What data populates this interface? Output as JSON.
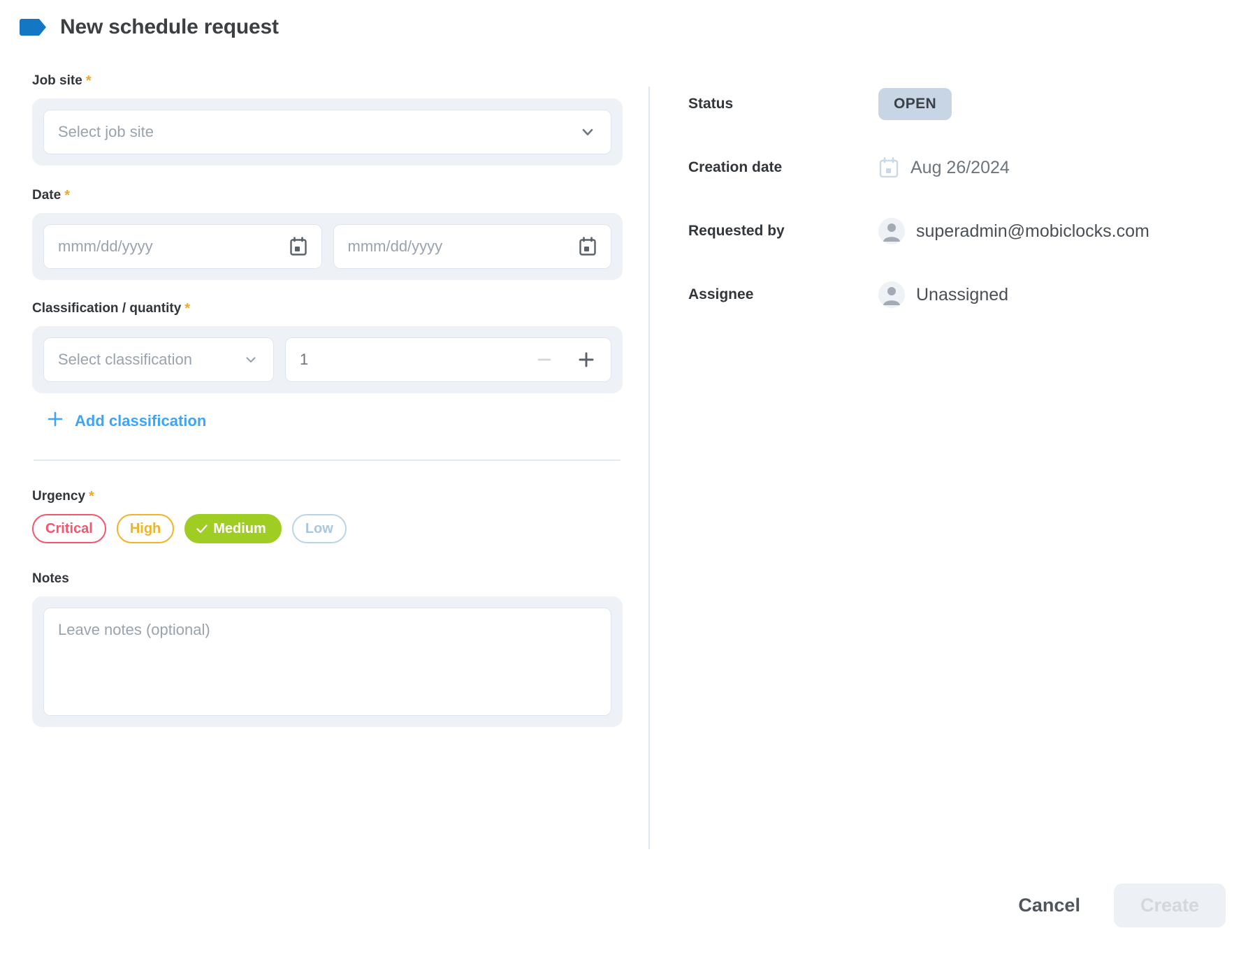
{
  "header": {
    "title": "New schedule request",
    "icon": "tag-icon",
    "icon_color": "#1477c4"
  },
  "form": {
    "job_site": {
      "label": "Job site",
      "required": true,
      "placeholder": "Select job site",
      "value": "",
      "icon": "chevron-down-icon"
    },
    "date": {
      "label": "Date",
      "required": true,
      "start_placeholder": "mmm/dd/yyyy",
      "end_placeholder": "mmm/dd/yyyy",
      "start_value": "",
      "end_value": "",
      "icon": "calendar-icon"
    },
    "classification": {
      "label": "Classification / quantity",
      "required": true,
      "placeholder": "Select classification",
      "value": "",
      "quantity": "1",
      "decrement_label": "−",
      "increment_label": "+",
      "add_label": "Add classification",
      "add_icon": "plus-icon"
    },
    "urgency": {
      "label": "Urgency",
      "required": true,
      "selected": "Medium",
      "options": [
        {
          "label": "Critical",
          "color": "#f4566c",
          "selected": false
        },
        {
          "label": "High",
          "color": "#f0b429",
          "selected": false
        },
        {
          "label": "Medium",
          "color": "#9fcd24",
          "selected": true
        },
        {
          "label": "Low",
          "color": "#a9c8de",
          "selected": false
        }
      ]
    },
    "notes": {
      "label": "Notes",
      "required": false,
      "placeholder": "Leave notes (optional)",
      "value": ""
    }
  },
  "details": {
    "status": {
      "label": "Status",
      "value": "OPEN",
      "badge_color": "#c7d5e4"
    },
    "creation_date": {
      "label": "Creation date",
      "value": "Aug 26/2024",
      "icon": "calendar-icon"
    },
    "requested_by": {
      "label": "Requested by",
      "value": "superadmin@mobiclocks.com",
      "icon": "avatar-icon"
    },
    "assignee": {
      "label": "Assignee",
      "value": "Unassigned",
      "icon": "avatar-icon"
    }
  },
  "footer": {
    "cancel_label": "Cancel",
    "create_label": "Create",
    "create_disabled": true
  }
}
